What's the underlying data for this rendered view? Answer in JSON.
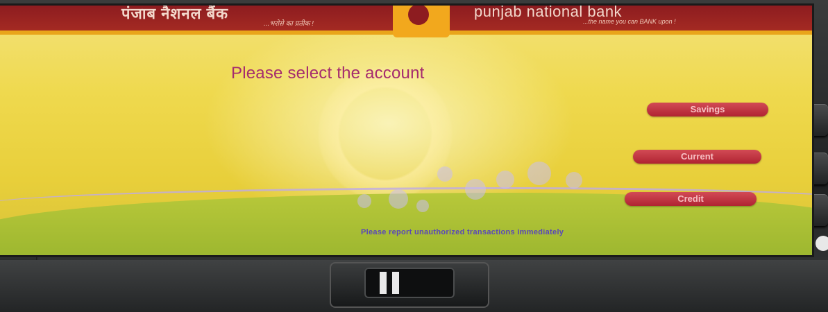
{
  "header": {
    "brand_hindi": "पंजाब नैशनल बैंक",
    "brand_hindi_tagline": "...भरोसे का प्रतीक !",
    "brand_english": "punjab national bank",
    "brand_english_tagline": "...the name you can BANK upon !"
  },
  "prompt": "Please select the account",
  "options": [
    {
      "label": "Savings"
    },
    {
      "label": "Current"
    },
    {
      "label": "Credit"
    }
  ],
  "notice": "Please report unauthorized transactions immediately",
  "colors": {
    "header_red": "#8d1c20",
    "accent_orange": "#e9a51a",
    "screen_yellow": "#efd94e",
    "prompt_purple": "#a52b6e",
    "button_red": "#c03542"
  }
}
